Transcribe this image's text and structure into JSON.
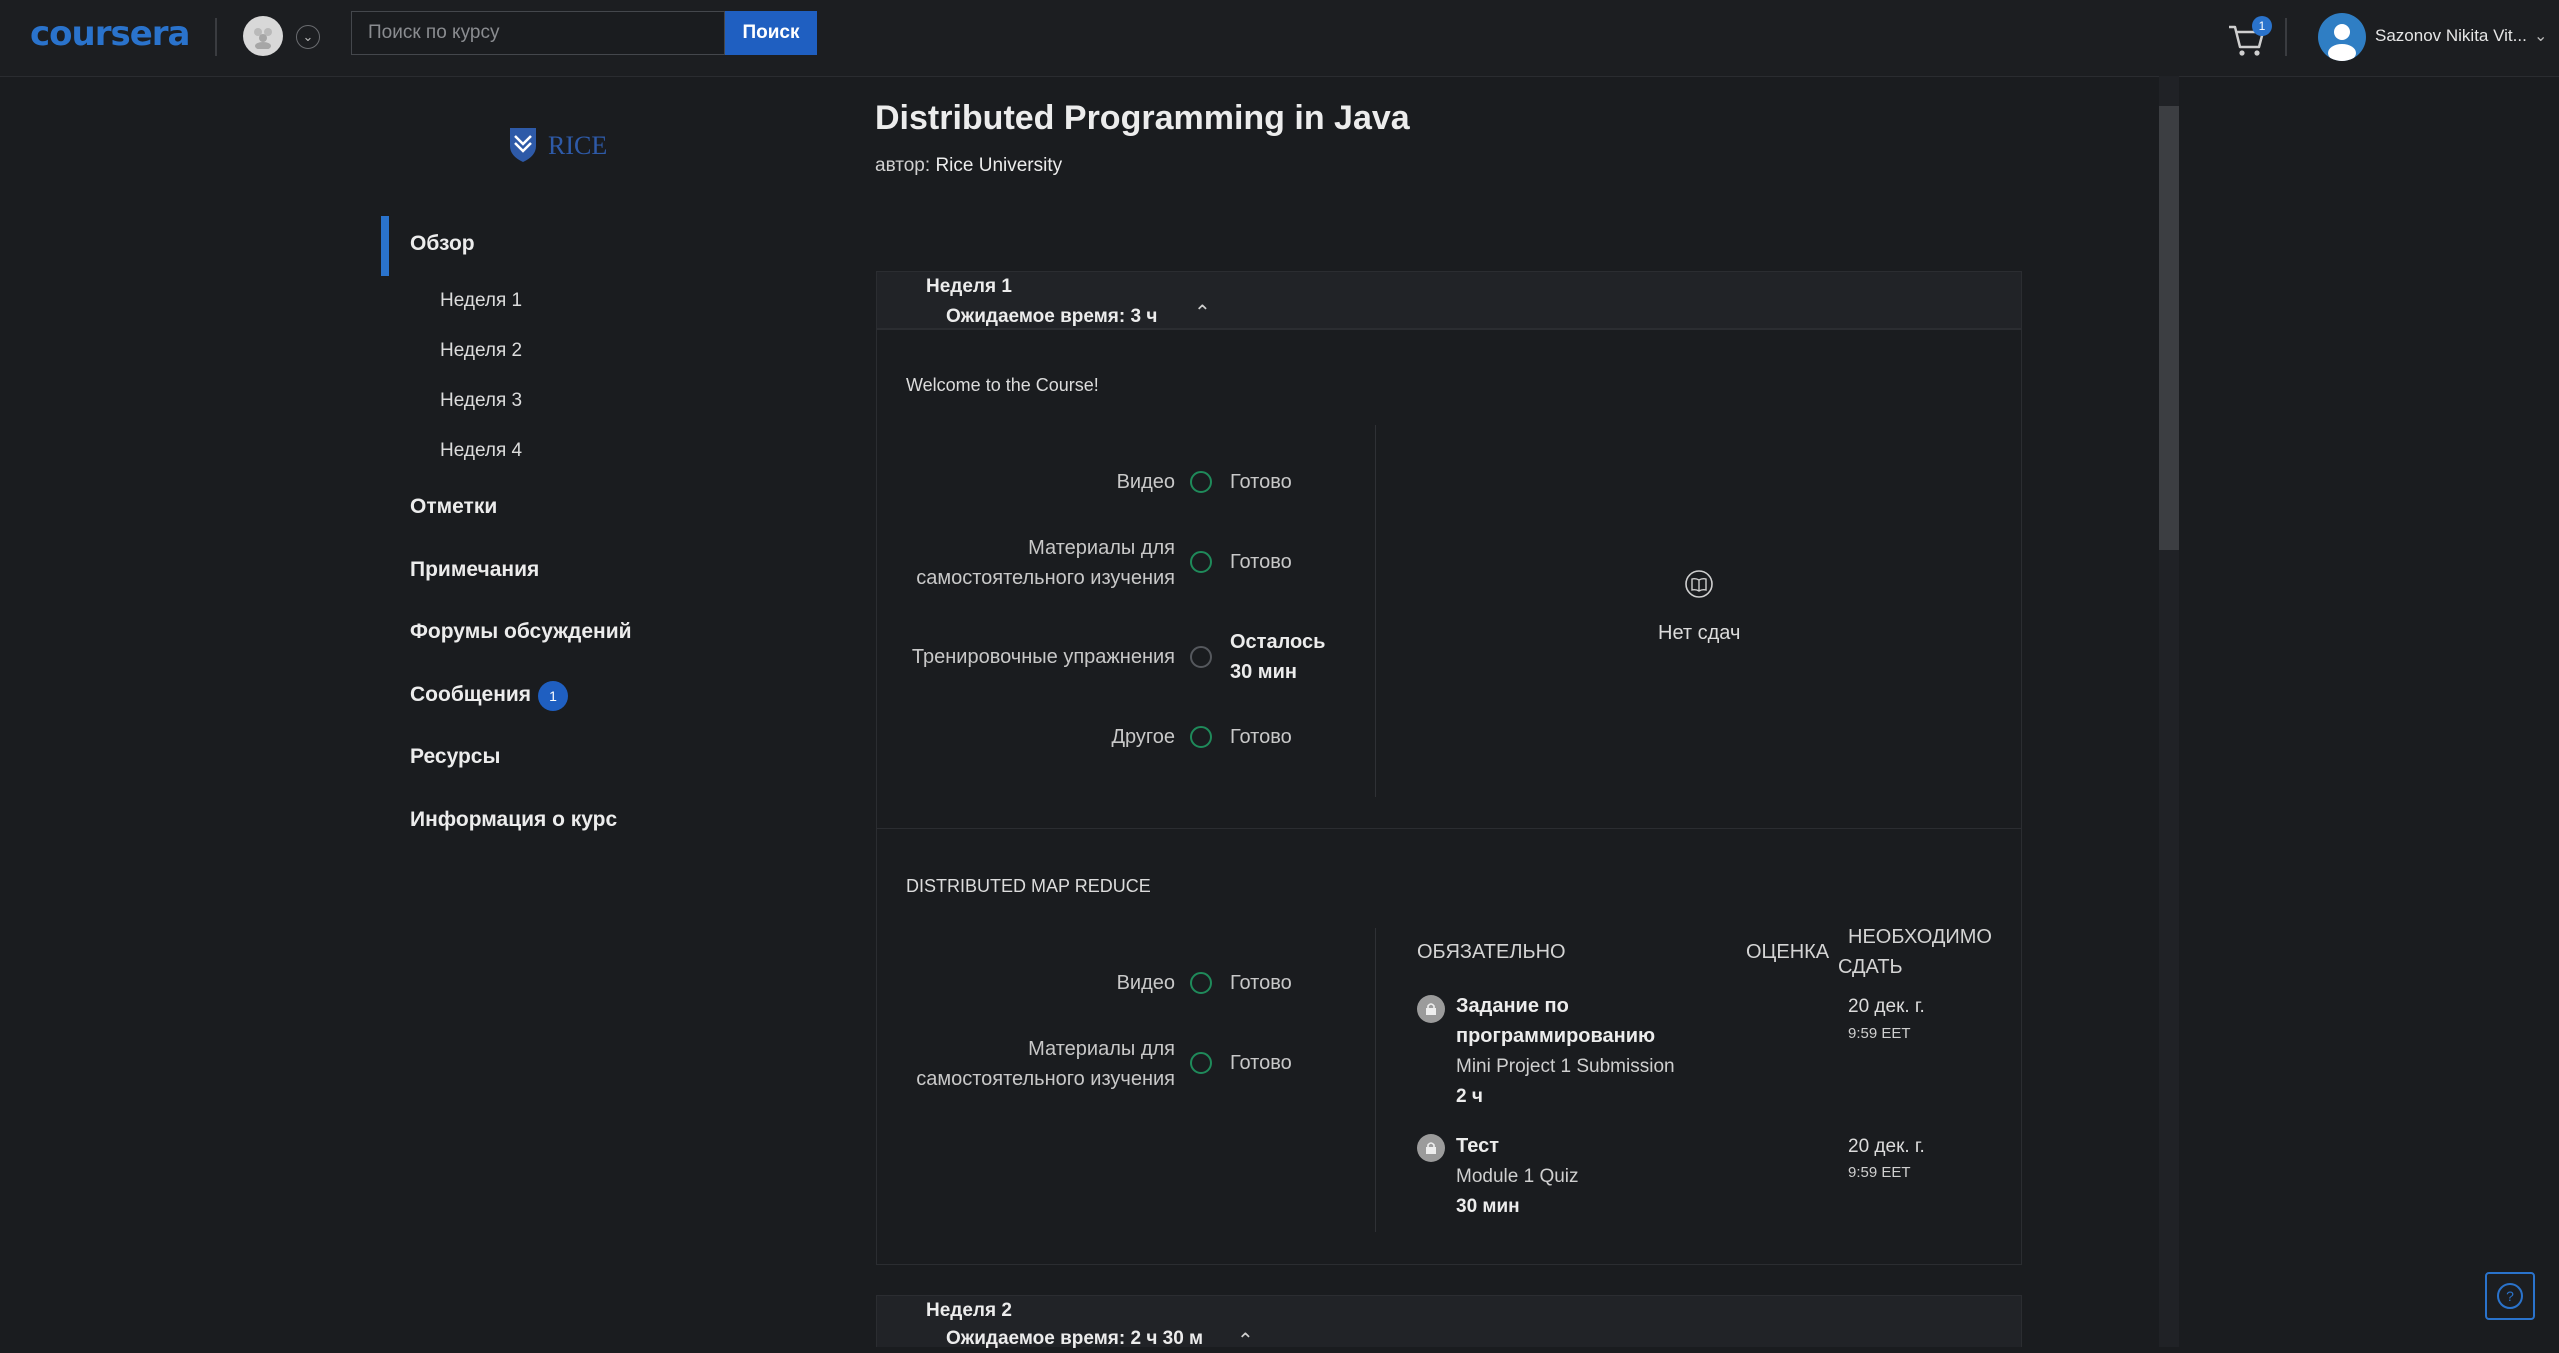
{
  "header": {
    "logo": "coursera",
    "search_placeholder": "Поиск по курсу",
    "search_button": "Поиск",
    "cart_count": "1",
    "user_name": "Sazonov Nikita Vit..."
  },
  "sidebar": {
    "university_logo": "RICE",
    "items": [
      {
        "label": "Обзор",
        "active": true
      },
      {
        "label": "Неделя 1"
      },
      {
        "label": "Неделя 2"
      },
      {
        "label": "Неделя 3"
      },
      {
        "label": "Неделя 4"
      },
      {
        "label": "Отметки"
      },
      {
        "label": "Примечания"
      },
      {
        "label": "Форумы обсуждений"
      },
      {
        "label": "Сообщения",
        "badge": "1"
      },
      {
        "label": "Ресурсы"
      },
      {
        "label": "Информация о курс"
      }
    ]
  },
  "course": {
    "title": "Distributed Programming in Java",
    "author_label": "автор:",
    "author": "Rice University"
  },
  "week1": {
    "title": "Неделя 1",
    "time": "Ожидаемое время: 3 ч",
    "section1": {
      "title": "Welcome to the Course!",
      "rows": [
        {
          "label": "Видео",
          "status": "Готово"
        },
        {
          "label_line1": "Материалы для",
          "label_line2": "самостоятельного изучения",
          "status": "Готово"
        },
        {
          "label": "Тренировочные упражнения",
          "status_line1": "Осталось",
          "status_line2": "30 мин"
        },
        {
          "label": "Другое",
          "status": "Готово"
        }
      ],
      "no_submissions": "Нет сдач"
    },
    "section2": {
      "title": "DISTRIBUTED MAP REDUCE",
      "rows": [
        {
          "label": "Видео",
          "status": "Готово"
        },
        {
          "label_line1": "Материалы для",
          "label_line2": "самостоятельного изучения",
          "status": "Готово"
        }
      ],
      "columns": {
        "required": "ОБЯЗАТЕЛЬНО",
        "grade": "ОЦЕНКА",
        "due_line1": "НЕОБХОДИМО",
        "due_line2": "СДАТЬ"
      },
      "tasks": [
        {
          "type_line1": "Задание по",
          "type_line2": "программированию",
          "name": "Mini Project 1 Submission",
          "duration": "2 ч",
          "due_date": "20 дек. г.",
          "due_time": "9:59 EET"
        },
        {
          "type_line1": "Тест",
          "name": "Module 1 Quiz",
          "duration": "30 мин",
          "due_date": "20 дек. г.",
          "due_time": "9:59 EET"
        }
      ]
    }
  },
  "week2": {
    "title": "Неделя 2",
    "time": "Ожидаемое время: 2 ч 30 м"
  },
  "colors": {
    "accent": "#2a73cc",
    "done": "#1f8a5a",
    "background": "#1a1c1f"
  },
  "icons": [
    "cart-icon",
    "user-icon",
    "lock-icon",
    "book-icon",
    "help-icon",
    "chevron-down-icon",
    "chevron-up-icon"
  ]
}
